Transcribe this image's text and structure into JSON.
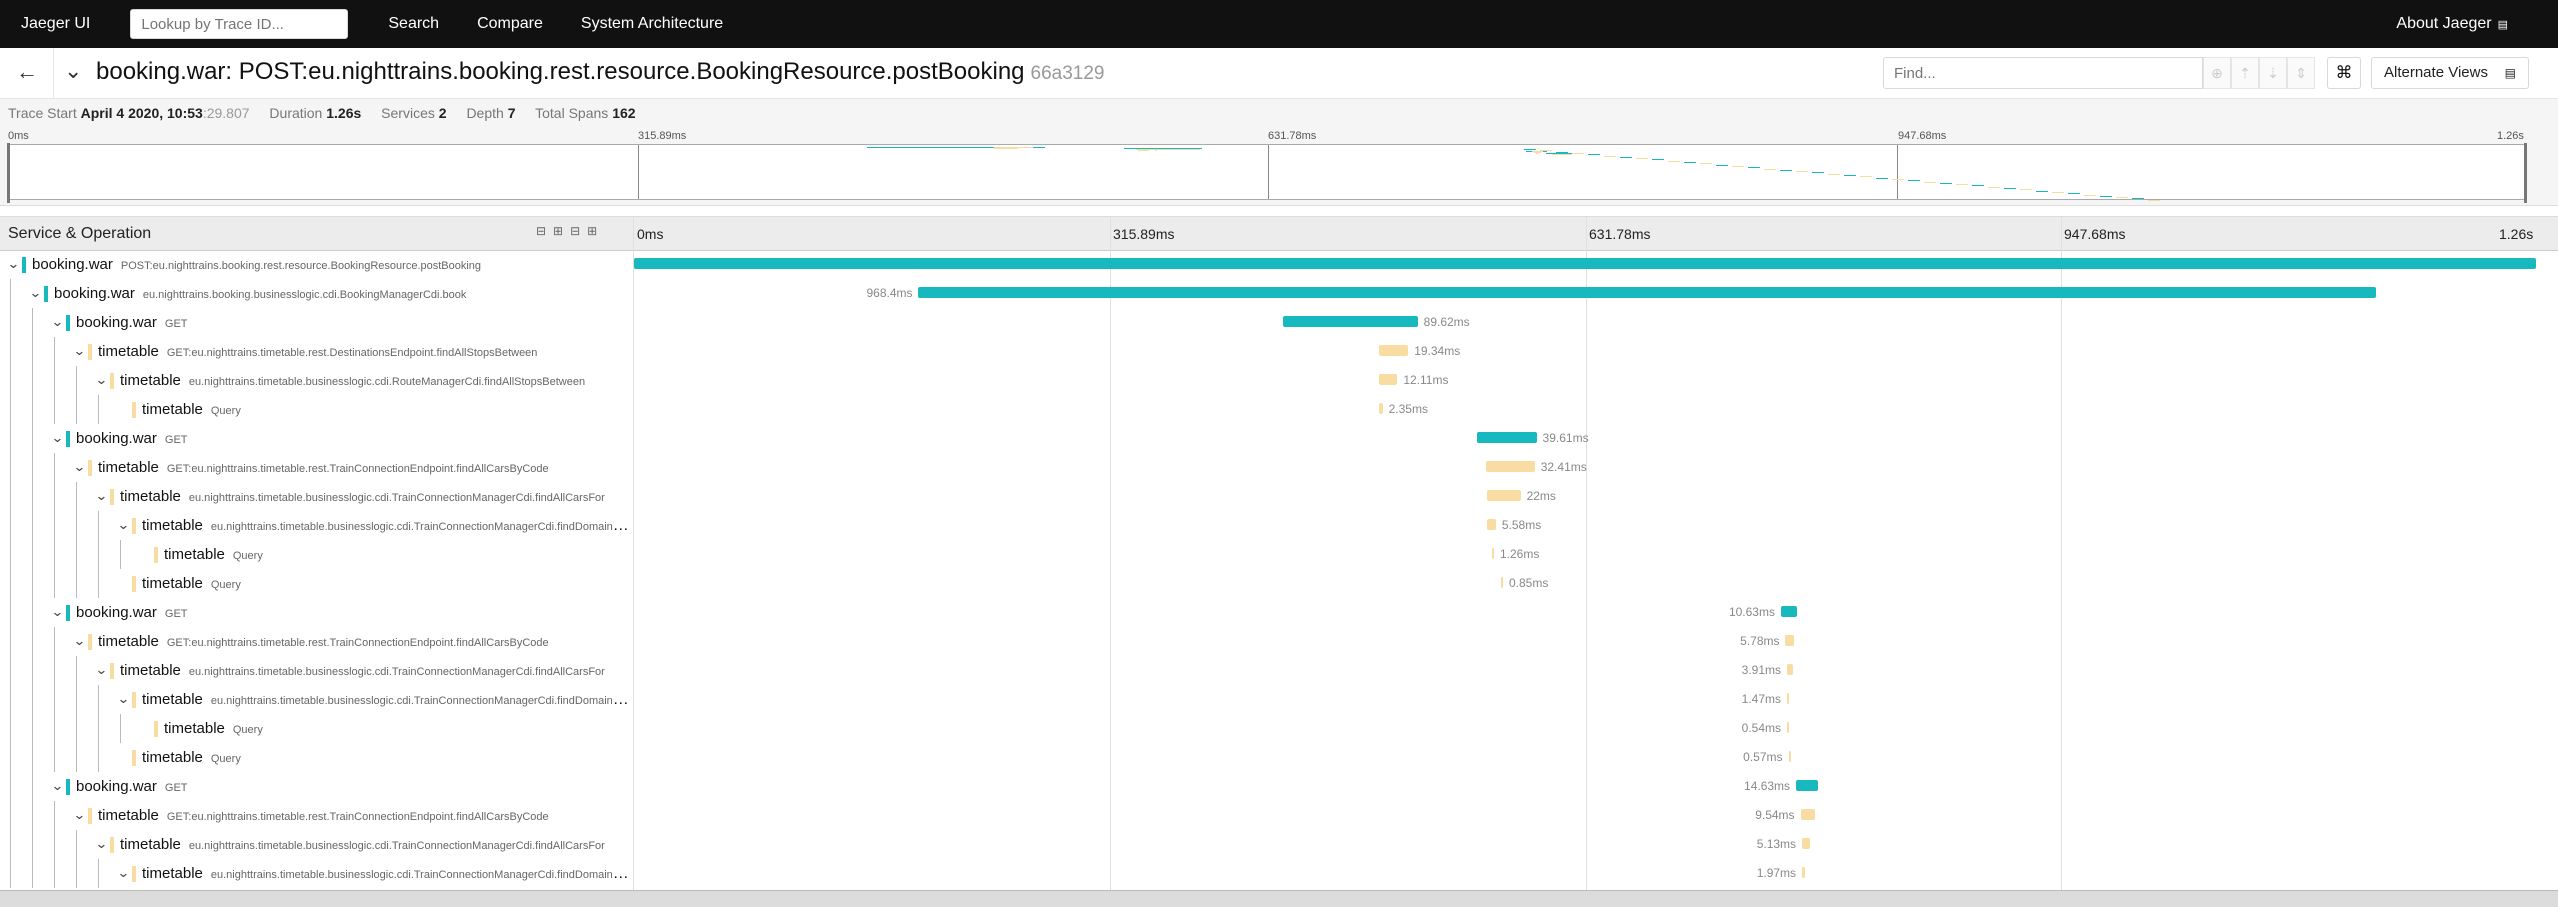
{
  "nav": {
    "brand": "Jaeger UI",
    "lookup_placeholder": "Lookup by Trace ID...",
    "links": [
      "Search",
      "Compare",
      "System Architecture"
    ],
    "about": "About Jaeger"
  },
  "trace": {
    "title": "booking.war: POST:eu.nighttrains.booking.rest.resource.BookingResource.postBooking",
    "id": "66a3129",
    "find_placeholder": "Find...",
    "alt_views": "Alternate Views"
  },
  "summary": {
    "trace_start_label": "Trace Start",
    "trace_start_value": "April 4 2020, 10:53",
    "trace_start_ms": ":29.807",
    "duration_label": "Duration",
    "duration_value": "1.26s",
    "services_label": "Services",
    "services_value": "2",
    "depth_label": "Depth",
    "depth_value": "7",
    "total_spans_label": "Total Spans",
    "total_spans_value": "162"
  },
  "timeline": {
    "header_label": "Service & Operation",
    "ticks": [
      "0ms",
      "315.89ms",
      "631.78ms",
      "947.68ms",
      "1.26s"
    ],
    "total_ms": 1263.6
  },
  "colors": {
    "booking": "#17b8be",
    "timetable": "#f8dca1"
  },
  "spans": [
    {
      "depth": 0,
      "service": "booking.war",
      "op": "POST:eu.nighttrains.booking.rest.resource.BookingResource.postBooking",
      "start": 0,
      "dur": 1263.6,
      "label": "",
      "expanded": true
    },
    {
      "depth": 1,
      "service": "booking.war",
      "op": "eu.nighttrains.booking.businesslogic.cdi.BookingManagerCdi.book",
      "start": 189,
      "dur": 968.4,
      "label": "968.4ms",
      "expanded": true
    },
    {
      "depth": 2,
      "service": "booking.war",
      "op": "GET",
      "start": 431,
      "dur": 89.62,
      "label": "89.62ms",
      "expanded": true
    },
    {
      "depth": 3,
      "service": "timetable",
      "op": "GET:eu.nighttrains.timetable.rest.DestinationsEndpoint.findAllStopsBetween",
      "start": 495,
      "dur": 19.34,
      "label": "19.34ms",
      "expanded": true
    },
    {
      "depth": 4,
      "service": "timetable",
      "op": "eu.nighttrains.timetable.businesslogic.cdi.RouteManagerCdi.findAllStopsBetween",
      "start": 495,
      "dur": 12.11,
      "label": "12.11ms",
      "expanded": true
    },
    {
      "depth": 5,
      "service": "timetable",
      "op": "Query",
      "start": 495,
      "dur": 2.35,
      "label": "2.35ms",
      "expanded": null
    },
    {
      "depth": 2,
      "service": "booking.war",
      "op": "GET",
      "start": 560,
      "dur": 39.61,
      "label": "39.61ms",
      "expanded": true
    },
    {
      "depth": 3,
      "service": "timetable",
      "op": "GET:eu.nighttrains.timetable.rest.TrainConnectionEndpoint.findAllCarsByCode",
      "start": 566,
      "dur": 32.41,
      "label": "32.41ms",
      "expanded": true
    },
    {
      "depth": 4,
      "service": "timetable",
      "op": "eu.nighttrains.timetable.businesslogic.cdi.TrainConnectionManagerCdi.findAllCarsFor",
      "start": 567,
      "dur": 22,
      "label": "22ms",
      "expanded": true
    },
    {
      "depth": 5,
      "service": "timetable",
      "op": "eu.nighttrains.timetable.businesslogic.cdi.TrainConnectionManagerCdi.findDomainTrainCarsForTrainConnection",
      "start": 567,
      "dur": 5.58,
      "label": "5.58ms",
      "expanded": true
    },
    {
      "depth": 6,
      "service": "timetable",
      "op": "Query",
      "start": 570,
      "dur": 1.26,
      "label": "1.26ms",
      "expanded": null
    },
    {
      "depth": 5,
      "service": "timetable",
      "op": "Query",
      "start": 576,
      "dur": 0.85,
      "label": "0.85ms",
      "expanded": null
    },
    {
      "depth": 2,
      "service": "booking.war",
      "op": "GET",
      "start": 762,
      "dur": 10.63,
      "label": "10.63ms",
      "expanded": true
    },
    {
      "depth": 3,
      "service": "timetable",
      "op": "GET:eu.nighttrains.timetable.rest.TrainConnectionEndpoint.findAllCarsByCode",
      "start": 765,
      "dur": 5.78,
      "label": "5.78ms",
      "expanded": true
    },
    {
      "depth": 4,
      "service": "timetable",
      "op": "eu.nighttrains.timetable.businesslogic.cdi.TrainConnectionManagerCdi.findAllCarsFor",
      "start": 766,
      "dur": 3.91,
      "label": "3.91ms",
      "expanded": true
    },
    {
      "depth": 5,
      "service": "timetable",
      "op": "eu.nighttrains.timetable.businesslogic.cdi.TrainConnectionManagerCdi.findDomainTrainCarsForTrainConnection",
      "start": 766,
      "dur": 1.47,
      "label": "1.47ms",
      "expanded": true
    },
    {
      "depth": 6,
      "service": "timetable",
      "op": "Query",
      "start": 766,
      "dur": 0.54,
      "label": "0.54ms",
      "expanded": null
    },
    {
      "depth": 5,
      "service": "timetable",
      "op": "Query",
      "start": 767,
      "dur": 0.57,
      "label": "0.57ms",
      "expanded": null
    },
    {
      "depth": 2,
      "service": "booking.war",
      "op": "GET",
      "start": 772,
      "dur": 14.63,
      "label": "14.63ms",
      "expanded": true
    },
    {
      "depth": 3,
      "service": "timetable",
      "op": "GET:eu.nighttrains.timetable.rest.TrainConnectionEndpoint.findAllCarsByCode",
      "start": 775,
      "dur": 9.54,
      "label": "9.54ms",
      "expanded": true
    },
    {
      "depth": 4,
      "service": "timetable",
      "op": "eu.nighttrains.timetable.businesslogic.cdi.TrainConnectionManagerCdi.findAllCarsFor",
      "start": 776,
      "dur": 5.13,
      "label": "5.13ms",
      "expanded": true
    },
    {
      "depth": 5,
      "service": "timetable",
      "op": "eu.nighttrains.timetable.businesslogic.cdi.TrainConnectionManagerCdi.findDomainTrainCarsForTrainConnection",
      "start": 776,
      "dur": 1.97,
      "label": "1.97ms",
      "expanded": true
    }
  ]
}
